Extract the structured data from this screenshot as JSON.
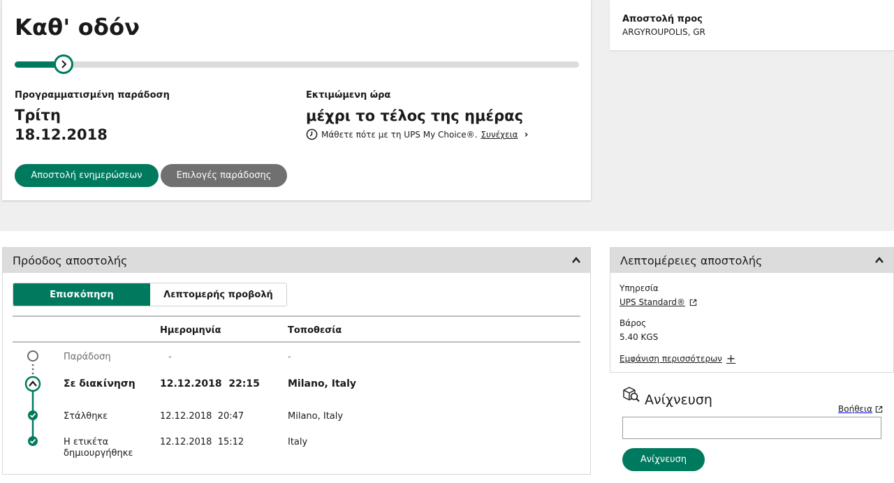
{
  "status": {
    "title": "Καθ' οδόν",
    "progress_fraction": 0.09,
    "scheduled_label": "Προγραμματισμένη παράδοση",
    "scheduled_day": "Τρίτη",
    "scheduled_date": "18.12.2018",
    "estimated_label": "Εκτιμώμενη ώρα",
    "estimated_time": "μέχρι το τέλος της ημέρας",
    "my_choice_text": "Μάθετε πότε με τη UPS My Choice®.",
    "my_choice_link": "Συνέχεια",
    "send_updates_button": "Αποστολή ενημερώσεων",
    "delivery_options_button": "Επιλογές παράδοσης"
  },
  "ship_to": {
    "label": "Αποστολή προς",
    "value": "ARGYROUPOLIS, GR"
  },
  "progress_panel": {
    "title": "Πρόοδος αποστολής",
    "tabs": [
      "Επισκόπηση",
      "Λεπτομερής προβολή"
    ],
    "columns": {
      "date": "Ημερομηνία",
      "location": "Τοποθεσία"
    },
    "rows": [
      {
        "status": "Παράδοση",
        "date": "-",
        "time": "",
        "location": "-",
        "state": "pending"
      },
      {
        "status": "Σε διακίνηση",
        "date": "12.12.2018",
        "time": "22:15",
        "location": "Milano, Italy",
        "state": "current"
      },
      {
        "status": "Στάλθηκε",
        "date": "12.12.2018",
        "time": "20:47",
        "location": "Milano, Italy",
        "state": "done"
      },
      {
        "status": "Η ετικέτα",
        "status_line2": "δημιουργήθηκε",
        "date": "12.12.2018",
        "time": "15:12",
        "location": "Italy",
        "state": "done"
      }
    ]
  },
  "details_panel": {
    "title": "Λεπτομέρειες αποστολής",
    "service_label": "Υπηρεσία",
    "service_value": "UPS Standard®",
    "weight_label": "Βάρος",
    "weight_value": "5.40 KGS",
    "show_more": "Εμφάνιση περισσότερων"
  },
  "tracking": {
    "title": "Ανίχνευση",
    "help_link": "Βοήθεια",
    "input_value": "",
    "button": "Ανίχνευση"
  },
  "colors": {
    "accent": "#007a5e",
    "secondary_button": "#707070",
    "header_gray": "#dcdcdc"
  }
}
